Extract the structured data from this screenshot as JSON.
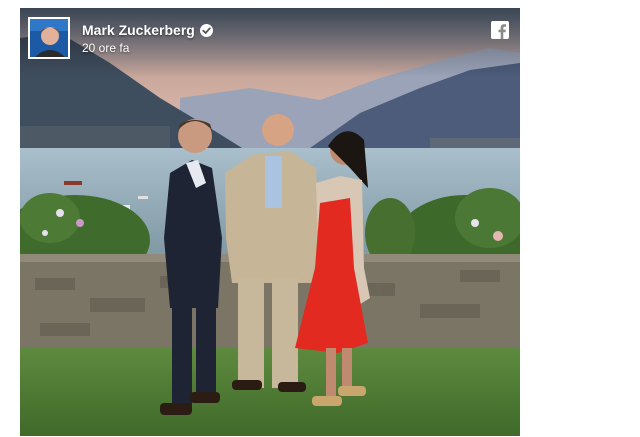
{
  "post": {
    "author_name": "Mark Zuckerberg",
    "timestamp": "20 ore fa",
    "verified": true
  },
  "icons": {
    "avatar": "profile-photo",
    "verified": "verified-badge-icon",
    "social": "facebook-icon"
  },
  "colors": {
    "header_text": "#ffffff",
    "avatar_bg": "#1c5aa6"
  }
}
